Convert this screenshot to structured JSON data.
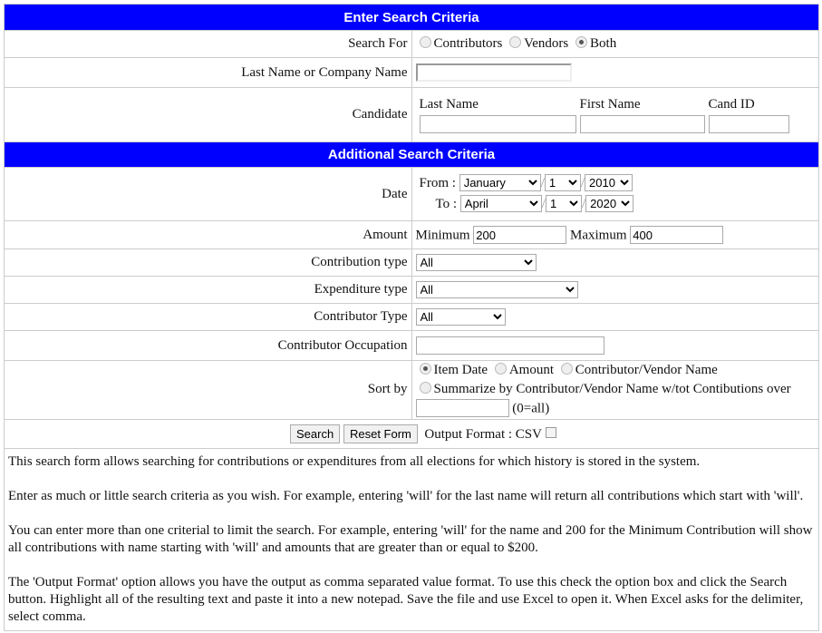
{
  "header1": "Enter Search Criteria",
  "search_for": {
    "label": "Search For",
    "options": [
      "Contributors",
      "Vendors",
      "Both"
    ],
    "selected": "Both"
  },
  "last_name_company": {
    "label": "Last Name or Company Name",
    "value": ""
  },
  "candidate": {
    "label": "Candidate",
    "last_name": "Last Name",
    "first_name": "First Name",
    "cand_id": "Cand ID"
  },
  "header2": "Additional Search Criteria",
  "date": {
    "label": "Date",
    "from_label": "From :",
    "to_label": "To :",
    "from": {
      "month": "January",
      "day": "1",
      "year": "2010"
    },
    "to": {
      "month": "April",
      "day": "1",
      "year": "2020"
    },
    "sep": "/"
  },
  "amount": {
    "label": "Amount",
    "min_label": "Minimum",
    "min": "200",
    "max_label": "Maximum",
    "max": "400"
  },
  "contribution_type": {
    "label": "Contribution type",
    "value": "All"
  },
  "expenditure_type": {
    "label": "Expenditure type",
    "value": "All"
  },
  "contributor_type": {
    "label": "Contributor Type",
    "value": "All"
  },
  "occupation": {
    "label": "Contributor Occupation",
    "value": ""
  },
  "sort_by": {
    "label": "Sort by",
    "options": [
      "Item Date",
      "Amount",
      "Contributor/Vendor Name"
    ],
    "summarize": "Summarize by Contributor/Vendor Name w/tot Contibutions over",
    "summarize_hint": "(0=all)",
    "selected": "Item Date"
  },
  "buttons": {
    "search": "Search",
    "reset": "Reset Form",
    "output_format": "Output Format : CSV"
  },
  "description": [
    "This search form allows searching for contributions or expenditures from all elections for which history is stored in the system.",
    "Enter as much or little search criteria as you wish. For example, entering 'will' for the last name will return all contributions which start with 'will'.",
    "You can enter more than one criterial to limit the search. For example, entering 'will' for the name and 200 for the Minimum Contribution will show all contributions with name starting with 'will' and amounts that are greater than or equal to $200.",
    "The 'Output Format' option allows you have the output as comma separated value format. To use this check the option box and click the Search button. Highlight all of the resulting text and paste it into a new notepad. Save the file and use Excel to open it. When Excel asks for the delimiter, select comma."
  ]
}
